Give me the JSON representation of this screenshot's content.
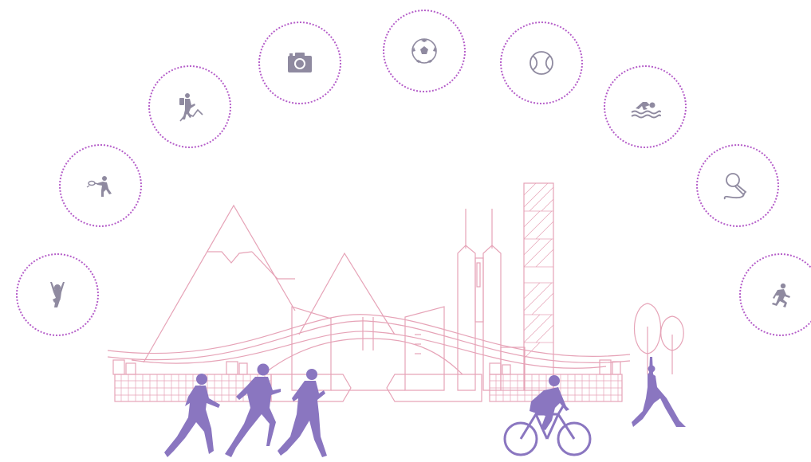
{
  "activities": [
    {
      "id": "yoga",
      "icon": "yoga-icon"
    },
    {
      "id": "badminton",
      "icon": "badminton-icon"
    },
    {
      "id": "hiking",
      "icon": "hiking-icon"
    },
    {
      "id": "photography",
      "icon": "camera-icon"
    },
    {
      "id": "football",
      "icon": "soccer-ball-icon"
    },
    {
      "id": "tennis",
      "icon": "tennis-ball-icon"
    },
    {
      "id": "swimming",
      "icon": "swimming-icon"
    },
    {
      "id": "singing",
      "icon": "microphone-icon"
    },
    {
      "id": "running",
      "icon": "running-icon"
    }
  ],
  "colors": {
    "icon": "#8f8aa0",
    "dotted_ring": "#b55ec9",
    "city_lines": "#e6a3b7",
    "figures": "#8a76c0"
  }
}
